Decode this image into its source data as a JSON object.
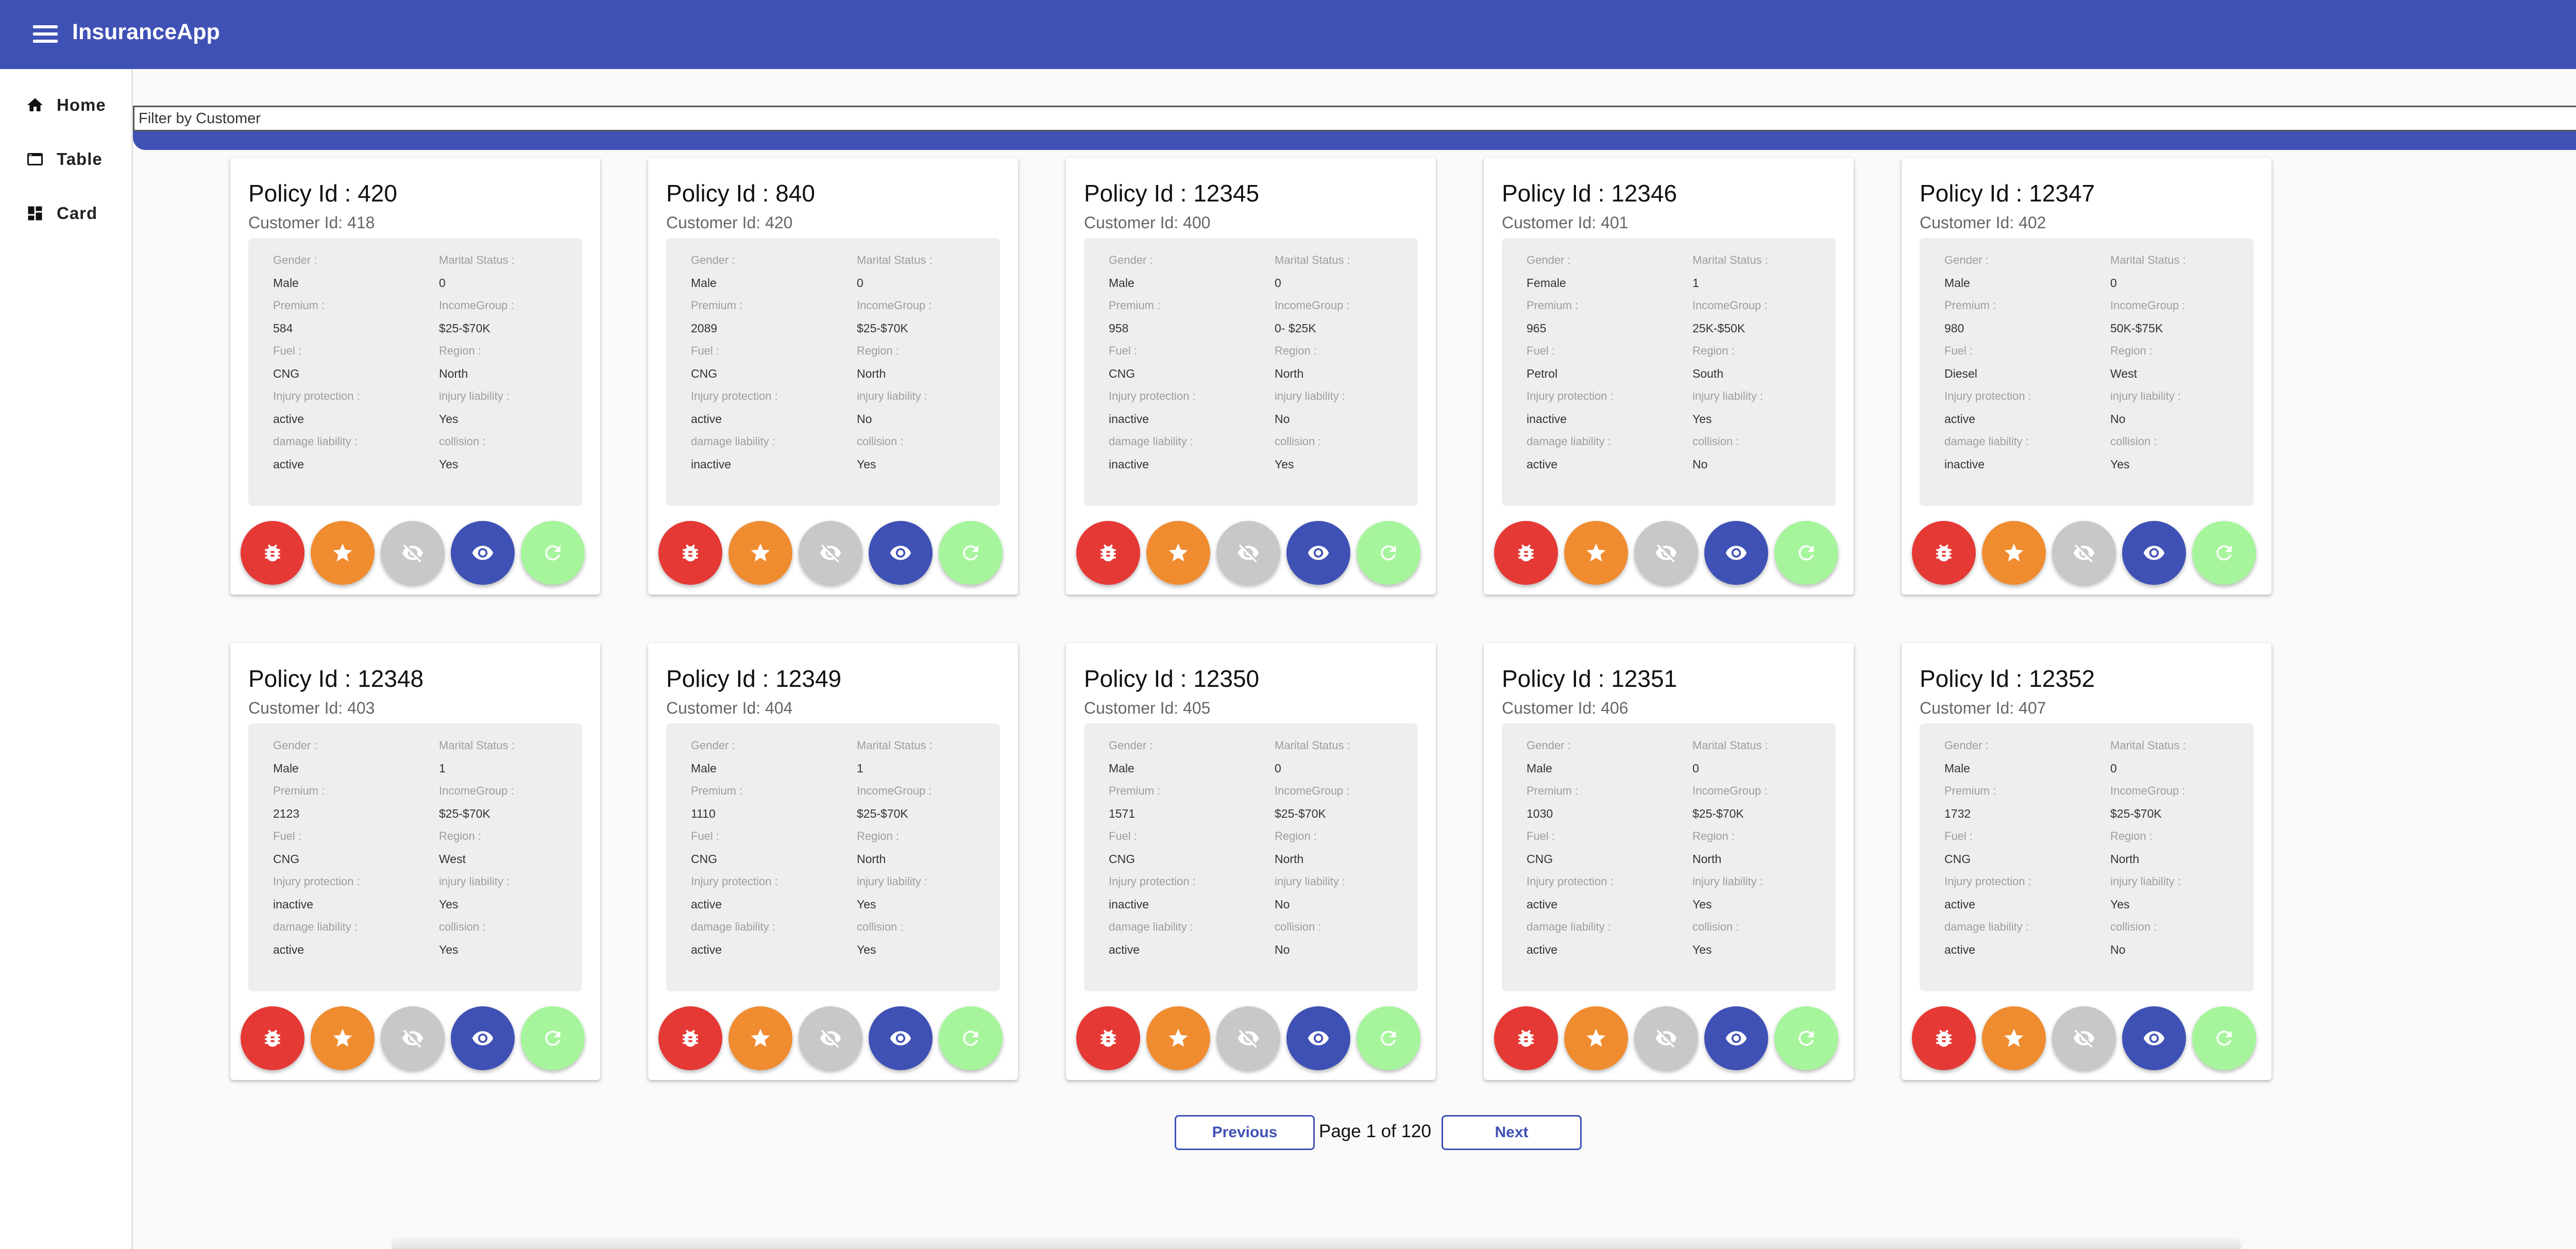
{
  "app": {
    "title": "InsuranceApp"
  },
  "sidebar": {
    "items": [
      {
        "label": "Home",
        "icon": "home-icon"
      },
      {
        "label": "Table",
        "icon": "table-icon"
      },
      {
        "label": "Card",
        "icon": "dashboard-icon"
      }
    ]
  },
  "filter": {
    "placeholder": "Filter by Customer",
    "value": ""
  },
  "labels": {
    "gender": "Gender :",
    "marital": "Marital Status :",
    "premium": "Premium :",
    "income": "IncomeGroup :",
    "fuel": "Fuel :",
    "region": "Region :",
    "injury_protection": "Injury protection :",
    "injury_liability": "injury liability :",
    "damage_liability": "damage liability :",
    "collision": "collision :"
  },
  "actions": [
    {
      "icon": "bug-icon",
      "color": "#e53935"
    },
    {
      "icon": "star-icon",
      "color": "#f08c30"
    },
    {
      "icon": "visibility-off-icon",
      "color": "#c8c8c8"
    },
    {
      "icon": "eye-icon",
      "color": "#3f51b5"
    },
    {
      "icon": "refresh-icon",
      "color": "#a6f59c"
    }
  ],
  "cards": [
    {
      "title": "Policy Id : 420",
      "customer": "Customer Id: 418",
      "gender": "Male",
      "marital": "0",
      "premium": "584",
      "income": "$25-$70K",
      "fuel": "CNG",
      "region": "North",
      "injury_protection": "active",
      "injury_liability": "Yes",
      "damage_liability": "active",
      "collision": "Yes"
    },
    {
      "title": "Policy Id : 840",
      "customer": "Customer Id: 420",
      "gender": "Male",
      "marital": "0",
      "premium": "2089",
      "income": "$25-$70K",
      "fuel": "CNG",
      "region": "North",
      "injury_protection": "active",
      "injury_liability": "No",
      "damage_liability": "inactive",
      "collision": "Yes"
    },
    {
      "title": "Policy Id : 12345",
      "customer": "Customer Id: 400",
      "gender": "Male",
      "marital": "0",
      "premium": "958",
      "income": "0- $25K",
      "fuel": "CNG",
      "region": "North",
      "injury_protection": "inactive",
      "injury_liability": "No",
      "damage_liability": "inactive",
      "collision": "Yes"
    },
    {
      "title": "Policy Id : 12346",
      "customer": "Customer Id: 401",
      "gender": "Female",
      "marital": "1",
      "premium": "965",
      "income": "25K-$50K",
      "fuel": "Petrol",
      "region": "South",
      "injury_protection": "inactive",
      "injury_liability": "Yes",
      "damage_liability": "active",
      "collision": "No"
    },
    {
      "title": "Policy Id : 12347",
      "customer": "Customer Id: 402",
      "gender": "Male",
      "marital": "0",
      "premium": "980",
      "income": "50K-$75K",
      "fuel": "Diesel",
      "region": "West",
      "injury_protection": "active",
      "injury_liability": "No",
      "damage_liability": "inactive",
      "collision": "Yes"
    },
    {
      "title": "Policy Id : 12348",
      "customer": "Customer Id: 403",
      "gender": "Male",
      "marital": "1",
      "premium": "2123",
      "income": "$25-$70K",
      "fuel": "CNG",
      "region": "West",
      "injury_protection": "inactive",
      "injury_liability": "Yes",
      "damage_liability": "active",
      "collision": "Yes"
    },
    {
      "title": "Policy Id : 12349",
      "customer": "Customer Id: 404",
      "gender": "Male",
      "marital": "1",
      "premium": "1110",
      "income": "$25-$70K",
      "fuel": "CNG",
      "region": "North",
      "injury_protection": "active",
      "injury_liability": "Yes",
      "damage_liability": "active",
      "collision": "Yes"
    },
    {
      "title": "Policy Id : 12350",
      "customer": "Customer Id: 405",
      "gender": "Male",
      "marital": "0",
      "premium": "1571",
      "income": "$25-$70K",
      "fuel": "CNG",
      "region": "North",
      "injury_protection": "inactive",
      "injury_liability": "No",
      "damage_liability": "active",
      "collision": "No"
    },
    {
      "title": "Policy Id : 12351",
      "customer": "Customer Id: 406",
      "gender": "Male",
      "marital": "0",
      "premium": "1030",
      "income": "$25-$70K",
      "fuel": "CNG",
      "region": "North",
      "injury_protection": "active",
      "injury_liability": "Yes",
      "damage_liability": "active",
      "collision": "Yes"
    },
    {
      "title": "Policy Id : 12352",
      "customer": "Customer Id: 407",
      "gender": "Male",
      "marital": "0",
      "premium": "1732",
      "income": "$25-$70K",
      "fuel": "CNG",
      "region": "North",
      "injury_protection": "active",
      "injury_liability": "Yes",
      "damage_liability": "active",
      "collision": "No"
    }
  ],
  "pagination": {
    "previous": "Previous",
    "info": "Page 1 of 120",
    "next": "Next"
  }
}
